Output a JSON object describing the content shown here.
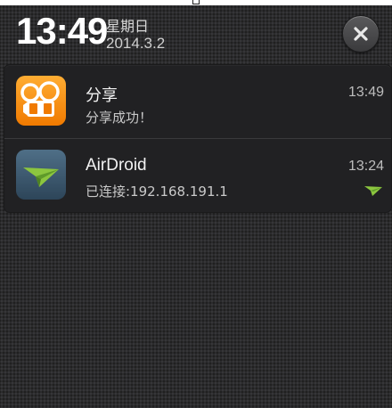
{
  "status": {
    "time": "13:49",
    "weekday": "星期日",
    "date": "2014.3.2"
  },
  "close_button": {
    "icon": "close-icon"
  },
  "notifications": [
    {
      "app": "分享",
      "message": "分享成功！",
      "time": "13:49",
      "icon": "share-app-icon",
      "icon_color": "#f5901e"
    },
    {
      "app": "AirDroid",
      "message": "已连接:192.168.191.1",
      "time": "13:24",
      "icon": "airdroid-paper-plane-icon",
      "icon_color": "#7ac143"
    }
  ]
}
